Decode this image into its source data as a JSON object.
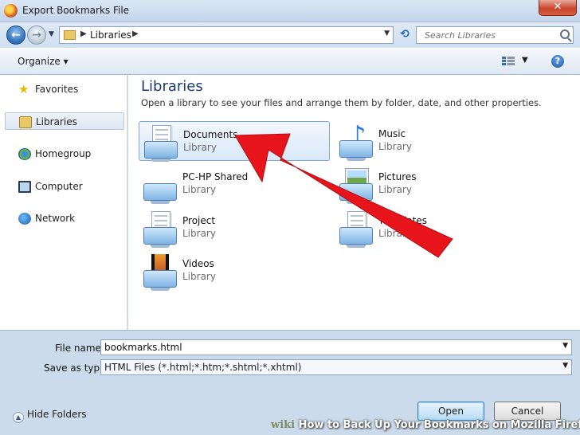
{
  "window": {
    "title": "Export Bookmarks File",
    "close_label": "✕"
  },
  "address": {
    "crumb": "Libraries",
    "search_placeholder": "Search Libraries"
  },
  "toolbar": {
    "organize_label": "Organize ▾",
    "help_label": "?"
  },
  "navpane": {
    "items": [
      {
        "label": "Favorites"
      },
      {
        "label": "Libraries"
      },
      {
        "label": "Homegroup"
      },
      {
        "label": "Computer"
      },
      {
        "label": "Network"
      }
    ]
  },
  "content": {
    "title": "Libraries",
    "subtitle": "Open a library to see your files and arrange them by folder, date, and other properties.",
    "libraries": [
      {
        "name": "Documents",
        "type": "Library"
      },
      {
        "name": "Music",
        "type": "Library"
      },
      {
        "name": "PC-HP Shared",
        "type": "Library"
      },
      {
        "name": "Pictures",
        "type": "Library"
      },
      {
        "name": "Project",
        "type": "Library"
      },
      {
        "name": "Templates",
        "type": "Library"
      },
      {
        "name": "Videos",
        "type": "Library"
      }
    ]
  },
  "bottom": {
    "filename_label": "File name:",
    "filename_value": "bookmarks.html",
    "savetype_label": "Save as type:",
    "savetype_value": "HTML Files (*.html;*.htm;*.shtml;*.xhtml)",
    "hide_folders_label": "Hide Folders",
    "open_label": "Open",
    "cancel_label": "Cancel"
  },
  "watermark": {
    "brand": "wiki",
    "text": "How to Back Up Your Bookmarks on Mozilla Firefox"
  },
  "colors": {
    "arrow": "#e8141b",
    "accent": "#2c6cb6",
    "chrome": "#cbdbeb"
  }
}
